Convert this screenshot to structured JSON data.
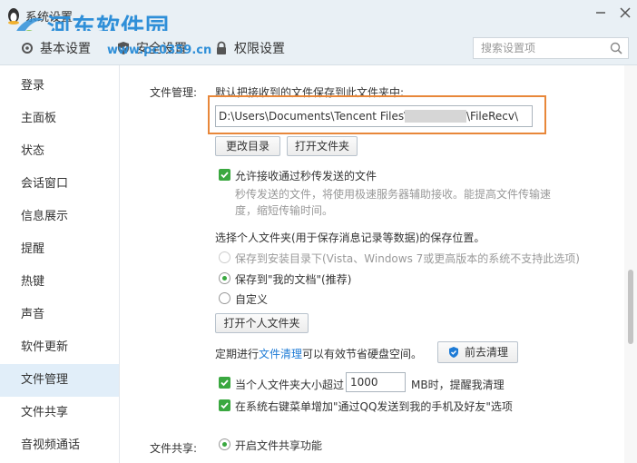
{
  "window": {
    "title": "系统设置",
    "watermark_title": "河东软件园",
    "watermark_url": "www.pc0359.cn"
  },
  "tabs": [
    {
      "label": "基本设置"
    },
    {
      "label": "安全设置"
    },
    {
      "label": "权限设置"
    }
  ],
  "search": {
    "placeholder": "搜索设置项"
  },
  "sidebar": {
    "items": [
      {
        "label": "登录"
      },
      {
        "label": "主面板"
      },
      {
        "label": "状态"
      },
      {
        "label": "会话窗口"
      },
      {
        "label": "信息展示"
      },
      {
        "label": "提醒"
      },
      {
        "label": "热键"
      },
      {
        "label": "声音"
      },
      {
        "label": "软件更新"
      },
      {
        "label": "文件管理"
      },
      {
        "label": "文件共享"
      },
      {
        "label": "音视频通话"
      }
    ],
    "active_index": 9
  },
  "file_management": {
    "section_label": "文件管理:",
    "default_path_desc": "默认把接收到的文件保存到此文件夹中:",
    "path_prefix": "D:\\Users\\Documents\\Tencent Files\\",
    "path_suffix": "\\FileRecv\\",
    "change_dir_button": "更改目录",
    "open_folder_button": "打开文件夹",
    "allow_instant_label": "允许接收通过秒传发送的文件",
    "allow_instant_checked": true,
    "instant_desc_line1": "秒传发送的文件，将使用极速服务器辅助接收。能提高文件传输速",
    "instant_desc_line2": "度，缩短传输时间。",
    "personal_folder_desc": "选择个人文件夹(用于保存消息记录等数据)的保存位置。",
    "radio_install_dir": "保存到安装目录下(Vista、Windows 7或更高版本的系统不支持此选项)",
    "radio_my_docs": "保存到\"我的文档\"(推荐)",
    "radio_custom": "自定义",
    "open_personal_button": "打开个人文件夹",
    "cleanup_prefix": "定期进行",
    "cleanup_link": "文件清理",
    "cleanup_suffix": "可以有效节省硬盘空间。",
    "cleanup_button": "前去清理",
    "size_limit_prefix": "当个人文件夹大小超过",
    "size_limit_value": "1000",
    "size_limit_suffix": "MB时，提醒我清理",
    "size_limit_checked": true,
    "context_menu_label": "在系统右键菜单增加\"通过QQ发送到我的手机及好友\"选项",
    "context_menu_checked": true
  },
  "file_sharing": {
    "section_label": "文件共享:",
    "enable_label": "开启文件共享功能",
    "enable_selected": true
  },
  "colors": {
    "accent": "#1e7bd6",
    "check_green": "#3aa840",
    "highlight_border": "#e8873a",
    "active_nav_bg": "#e1eef9"
  }
}
